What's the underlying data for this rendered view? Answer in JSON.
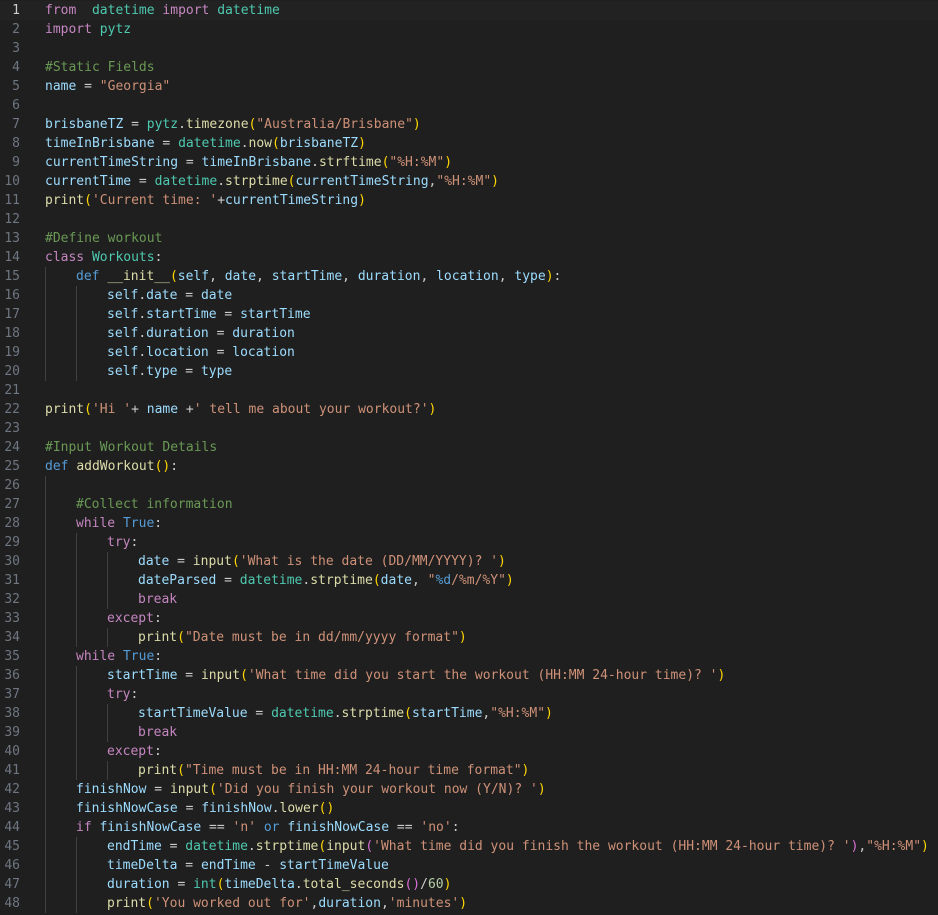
{
  "editor": {
    "language": "python",
    "current_line": 1,
    "lines": [
      {
        "n": "1",
        "indent": 0,
        "tokens": [
          [
            "kw",
            "from"
          ],
          [
            "",
            "  "
          ],
          [
            "cls",
            "datetime"
          ],
          [
            "",
            " "
          ],
          [
            "kw",
            "import"
          ],
          [
            "",
            " "
          ],
          [
            "cls",
            "datetime"
          ]
        ]
      },
      {
        "n": "2",
        "indent": 0,
        "tokens": [
          [
            "kw",
            "import"
          ],
          [
            "",
            " "
          ],
          [
            "cls",
            "pytz"
          ]
        ]
      },
      {
        "n": "3",
        "indent": 0,
        "tokens": []
      },
      {
        "n": "4",
        "indent": 0,
        "tokens": [
          [
            "com",
            "#Static Fields"
          ]
        ]
      },
      {
        "n": "5",
        "indent": 0,
        "tokens": [
          [
            "var",
            "name"
          ],
          [
            "",
            " = "
          ],
          [
            "str",
            "\"Georgia\""
          ]
        ]
      },
      {
        "n": "6",
        "indent": 0,
        "tokens": []
      },
      {
        "n": "7",
        "indent": 0,
        "tokens": [
          [
            "var",
            "brisbaneTZ"
          ],
          [
            "",
            " = "
          ],
          [
            "cls",
            "pytz"
          ],
          [
            "",
            "."
          ],
          [
            "fn",
            "timezone"
          ],
          [
            "brk1",
            "("
          ],
          [
            "str",
            "\"Australia/Brisbane\""
          ],
          [
            "brk1",
            ")"
          ]
        ]
      },
      {
        "n": "8",
        "indent": 0,
        "tokens": [
          [
            "var",
            "timeInBrisbane"
          ],
          [
            "",
            " = "
          ],
          [
            "cls",
            "datetime"
          ],
          [
            "",
            "."
          ],
          [
            "fn",
            "now"
          ],
          [
            "brk1",
            "("
          ],
          [
            "var",
            "brisbaneTZ"
          ],
          [
            "brk1",
            ")"
          ]
        ]
      },
      {
        "n": "9",
        "indent": 0,
        "tokens": [
          [
            "var",
            "currentTimeString"
          ],
          [
            "",
            " = "
          ],
          [
            "var",
            "timeInBrisbane"
          ],
          [
            "",
            "."
          ],
          [
            "fn",
            "strftime"
          ],
          [
            "brk1",
            "("
          ],
          [
            "str",
            "\"%H:%M\""
          ],
          [
            "brk1",
            ")"
          ]
        ]
      },
      {
        "n": "10",
        "indent": 0,
        "tokens": [
          [
            "var",
            "currentTime"
          ],
          [
            "",
            " = "
          ],
          [
            "cls",
            "datetime"
          ],
          [
            "",
            "."
          ],
          [
            "fn",
            "strptime"
          ],
          [
            "brk1",
            "("
          ],
          [
            "var",
            "currentTimeString"
          ],
          [
            "",
            ","
          ],
          [
            "str",
            "\"%H:%M\""
          ],
          [
            "brk1",
            ")"
          ]
        ]
      },
      {
        "n": "11",
        "indent": 0,
        "tokens": [
          [
            "fn",
            "print"
          ],
          [
            "brk1",
            "("
          ],
          [
            "str",
            "'Current time: '"
          ],
          [
            "",
            "+"
          ],
          [
            "var",
            "currentTimeString"
          ],
          [
            "brk1",
            ")"
          ]
        ]
      },
      {
        "n": "12",
        "indent": 0,
        "tokens": []
      },
      {
        "n": "13",
        "indent": 0,
        "tokens": [
          [
            "com",
            "#Define workout"
          ]
        ]
      },
      {
        "n": "14",
        "indent": 0,
        "tokens": [
          [
            "kw",
            "class"
          ],
          [
            "",
            " "
          ],
          [
            "cls",
            "Workouts"
          ],
          [
            "",
            ":"
          ]
        ]
      },
      {
        "n": "15",
        "indent": 1,
        "tokens": [
          [
            "dkw",
            "def"
          ],
          [
            "",
            " "
          ],
          [
            "fn",
            "__init__"
          ],
          [
            "brk1",
            "("
          ],
          [
            "var",
            "self"
          ],
          [
            "",
            ", "
          ],
          [
            "var",
            "date"
          ],
          [
            "",
            ", "
          ],
          [
            "var",
            "startTime"
          ],
          [
            "",
            ", "
          ],
          [
            "var",
            "duration"
          ],
          [
            "",
            ", "
          ],
          [
            "var",
            "location"
          ],
          [
            "",
            ", "
          ],
          [
            "var",
            "type"
          ],
          [
            "brk1",
            ")"
          ],
          [
            "",
            ":"
          ]
        ]
      },
      {
        "n": "16",
        "indent": 2,
        "tokens": [
          [
            "var",
            "self"
          ],
          [
            "",
            "."
          ],
          [
            "var",
            "date"
          ],
          [
            "",
            " = "
          ],
          [
            "var",
            "date"
          ]
        ]
      },
      {
        "n": "17",
        "indent": 2,
        "tokens": [
          [
            "var",
            "self"
          ],
          [
            "",
            "."
          ],
          [
            "var",
            "startTime"
          ],
          [
            "",
            " = "
          ],
          [
            "var",
            "startTime"
          ]
        ]
      },
      {
        "n": "18",
        "indent": 2,
        "tokens": [
          [
            "var",
            "self"
          ],
          [
            "",
            "."
          ],
          [
            "var",
            "duration"
          ],
          [
            "",
            " = "
          ],
          [
            "var",
            "duration"
          ]
        ]
      },
      {
        "n": "19",
        "indent": 2,
        "tokens": [
          [
            "var",
            "self"
          ],
          [
            "",
            "."
          ],
          [
            "var",
            "location"
          ],
          [
            "",
            " = "
          ],
          [
            "var",
            "location"
          ]
        ]
      },
      {
        "n": "20",
        "indent": 2,
        "tokens": [
          [
            "var",
            "self"
          ],
          [
            "",
            "."
          ],
          [
            "var",
            "type"
          ],
          [
            "",
            " = "
          ],
          [
            "var",
            "type"
          ]
        ]
      },
      {
        "n": "21",
        "indent": 0,
        "tokens": []
      },
      {
        "n": "22",
        "indent": 0,
        "tokens": [
          [
            "fn",
            "print"
          ],
          [
            "brk1",
            "("
          ],
          [
            "str",
            "'Hi '"
          ],
          [
            "",
            "+ "
          ],
          [
            "var",
            "name"
          ],
          [
            "",
            " +"
          ],
          [
            "str",
            "' tell me about your workout?'"
          ],
          [
            "brk1",
            ")"
          ]
        ]
      },
      {
        "n": "23",
        "indent": 0,
        "tokens": []
      },
      {
        "n": "24",
        "indent": 0,
        "tokens": [
          [
            "com",
            "#Input Workout Details"
          ]
        ]
      },
      {
        "n": "25",
        "indent": 0,
        "tokens": [
          [
            "dkw",
            "def"
          ],
          [
            "",
            " "
          ],
          [
            "fn",
            "addWorkout"
          ],
          [
            "brk1",
            "()"
          ],
          [
            "",
            ":"
          ]
        ]
      },
      {
        "n": "26",
        "indent": 1,
        "tokens": []
      },
      {
        "n": "27",
        "indent": 1,
        "tokens": [
          [
            "com",
            "#Collect information"
          ]
        ]
      },
      {
        "n": "28",
        "indent": 1,
        "tokens": [
          [
            "kw",
            "while"
          ],
          [
            "",
            " "
          ],
          [
            "dkw",
            "True"
          ],
          [
            "",
            ":"
          ]
        ]
      },
      {
        "n": "29",
        "indent": 2,
        "tokens": [
          [
            "kw",
            "try"
          ],
          [
            "",
            ":"
          ]
        ]
      },
      {
        "n": "30",
        "indent": 3,
        "tokens": [
          [
            "var",
            "date"
          ],
          [
            "",
            " = "
          ],
          [
            "fn",
            "input"
          ],
          [
            "brk1",
            "("
          ],
          [
            "str",
            "'What is the date (DD/MM/YYYY)? '"
          ],
          [
            "brk1",
            ")"
          ]
        ]
      },
      {
        "n": "31",
        "indent": 3,
        "tokens": [
          [
            "var",
            "dateParsed"
          ],
          [
            "",
            " = "
          ],
          [
            "cls",
            "datetime"
          ],
          [
            "",
            "."
          ],
          [
            "fn",
            "strptime"
          ],
          [
            "brk1",
            "("
          ],
          [
            "var",
            "date"
          ],
          [
            "",
            ", "
          ],
          [
            "str",
            "\""
          ],
          [
            "dkw",
            "%d"
          ],
          [
            "str",
            "/%m/%Y\""
          ],
          [
            "brk1",
            ")"
          ]
        ]
      },
      {
        "n": "32",
        "indent": 3,
        "tokens": [
          [
            "kw",
            "break"
          ]
        ]
      },
      {
        "n": "33",
        "indent": 2,
        "tokens": [
          [
            "kw",
            "except"
          ],
          [
            "",
            ":"
          ]
        ]
      },
      {
        "n": "34",
        "indent": 3,
        "tokens": [
          [
            "fn",
            "print"
          ],
          [
            "brk1",
            "("
          ],
          [
            "str",
            "\"Date must be in dd/mm/yyyy format\""
          ],
          [
            "brk1",
            ")"
          ]
        ]
      },
      {
        "n": "35",
        "indent": 1,
        "tokens": [
          [
            "kw",
            "while"
          ],
          [
            "",
            " "
          ],
          [
            "dkw",
            "True"
          ],
          [
            "",
            ":"
          ]
        ]
      },
      {
        "n": "36",
        "indent": 2,
        "tokens": [
          [
            "var",
            "startTime"
          ],
          [
            "",
            " = "
          ],
          [
            "fn",
            "input"
          ],
          [
            "brk1",
            "("
          ],
          [
            "str",
            "'What time did you start the workout (HH:MM 24-hour time)? '"
          ],
          [
            "brk1",
            ")"
          ]
        ]
      },
      {
        "n": "37",
        "indent": 2,
        "tokens": [
          [
            "kw",
            "try"
          ],
          [
            "",
            ":"
          ]
        ]
      },
      {
        "n": "38",
        "indent": 3,
        "tokens": [
          [
            "var",
            "startTimeValue"
          ],
          [
            "",
            " = "
          ],
          [
            "cls",
            "datetime"
          ],
          [
            "",
            "."
          ],
          [
            "fn",
            "strptime"
          ],
          [
            "brk1",
            "("
          ],
          [
            "var",
            "startTime"
          ],
          [
            "",
            ","
          ],
          [
            "str",
            "\"%H:%M\""
          ],
          [
            "brk1",
            ")"
          ]
        ]
      },
      {
        "n": "39",
        "indent": 3,
        "tokens": [
          [
            "kw",
            "break"
          ]
        ]
      },
      {
        "n": "40",
        "indent": 2,
        "tokens": [
          [
            "kw",
            "except"
          ],
          [
            "",
            ":"
          ]
        ]
      },
      {
        "n": "41",
        "indent": 3,
        "tokens": [
          [
            "fn",
            "print"
          ],
          [
            "brk1",
            "("
          ],
          [
            "str",
            "\"Time must be in HH:MM 24-hour time format\""
          ],
          [
            "brk1",
            ")"
          ]
        ]
      },
      {
        "n": "42",
        "indent": 1,
        "tokens": [
          [
            "var",
            "finishNow"
          ],
          [
            "",
            " = "
          ],
          [
            "fn",
            "input"
          ],
          [
            "brk1",
            "("
          ],
          [
            "str",
            "'Did you finish your workout now (Y/N)? '"
          ],
          [
            "brk1",
            ")"
          ]
        ]
      },
      {
        "n": "43",
        "indent": 1,
        "tokens": [
          [
            "var",
            "finishNowCase"
          ],
          [
            "",
            " = "
          ],
          [
            "var",
            "finishNow"
          ],
          [
            "",
            "."
          ],
          [
            "fn",
            "lower"
          ],
          [
            "brk1",
            "()"
          ]
        ]
      },
      {
        "n": "44",
        "indent": 1,
        "tokens": [
          [
            "kw",
            "if"
          ],
          [
            "",
            " "
          ],
          [
            "var",
            "finishNowCase"
          ],
          [
            "",
            " == "
          ],
          [
            "str",
            "'n'"
          ],
          [
            "",
            " "
          ],
          [
            "dkw",
            "or"
          ],
          [
            "",
            " "
          ],
          [
            "var",
            "finishNowCase"
          ],
          [
            "",
            " == "
          ],
          [
            "str",
            "'no'"
          ],
          [
            "",
            ":"
          ]
        ]
      },
      {
        "n": "45",
        "indent": 2,
        "tokens": [
          [
            "var",
            "endTime"
          ],
          [
            "",
            " = "
          ],
          [
            "cls",
            "datetime"
          ],
          [
            "",
            "."
          ],
          [
            "fn",
            "strptime"
          ],
          [
            "brk1",
            "("
          ],
          [
            "fn",
            "input"
          ],
          [
            "brk2",
            "("
          ],
          [
            "str",
            "'What time did you finish the workout (HH:MM 24-hour time)? '"
          ],
          [
            "brk2",
            ")"
          ],
          [
            "",
            ","
          ],
          [
            "str",
            "\"%H:%M\""
          ],
          [
            "brk1",
            ")"
          ]
        ]
      },
      {
        "n": "46",
        "indent": 2,
        "tokens": [
          [
            "var",
            "timeDelta"
          ],
          [
            "",
            " = "
          ],
          [
            "var",
            "endTime"
          ],
          [
            "",
            " - "
          ],
          [
            "var",
            "startTimeValue"
          ]
        ]
      },
      {
        "n": "47",
        "indent": 2,
        "tokens": [
          [
            "var",
            "duration"
          ],
          [
            "",
            " = "
          ],
          [
            "cls",
            "int"
          ],
          [
            "brk1",
            "("
          ],
          [
            "var",
            "timeDelta"
          ],
          [
            "",
            "."
          ],
          [
            "fn",
            "total_seconds"
          ],
          [
            "brk2",
            "()"
          ],
          [
            "",
            "/"
          ],
          [
            "num",
            "60"
          ],
          [
            "brk1",
            ")"
          ]
        ]
      },
      {
        "n": "48",
        "indent": 2,
        "tokens": [
          [
            "fn",
            "print"
          ],
          [
            "brk1",
            "("
          ],
          [
            "str",
            "'You worked out for'"
          ],
          [
            "",
            ","
          ],
          [
            "var",
            "duration"
          ],
          [
            "",
            ","
          ],
          [
            "str",
            "'minutes'"
          ],
          [
            "brk1",
            ")"
          ]
        ]
      }
    ]
  }
}
